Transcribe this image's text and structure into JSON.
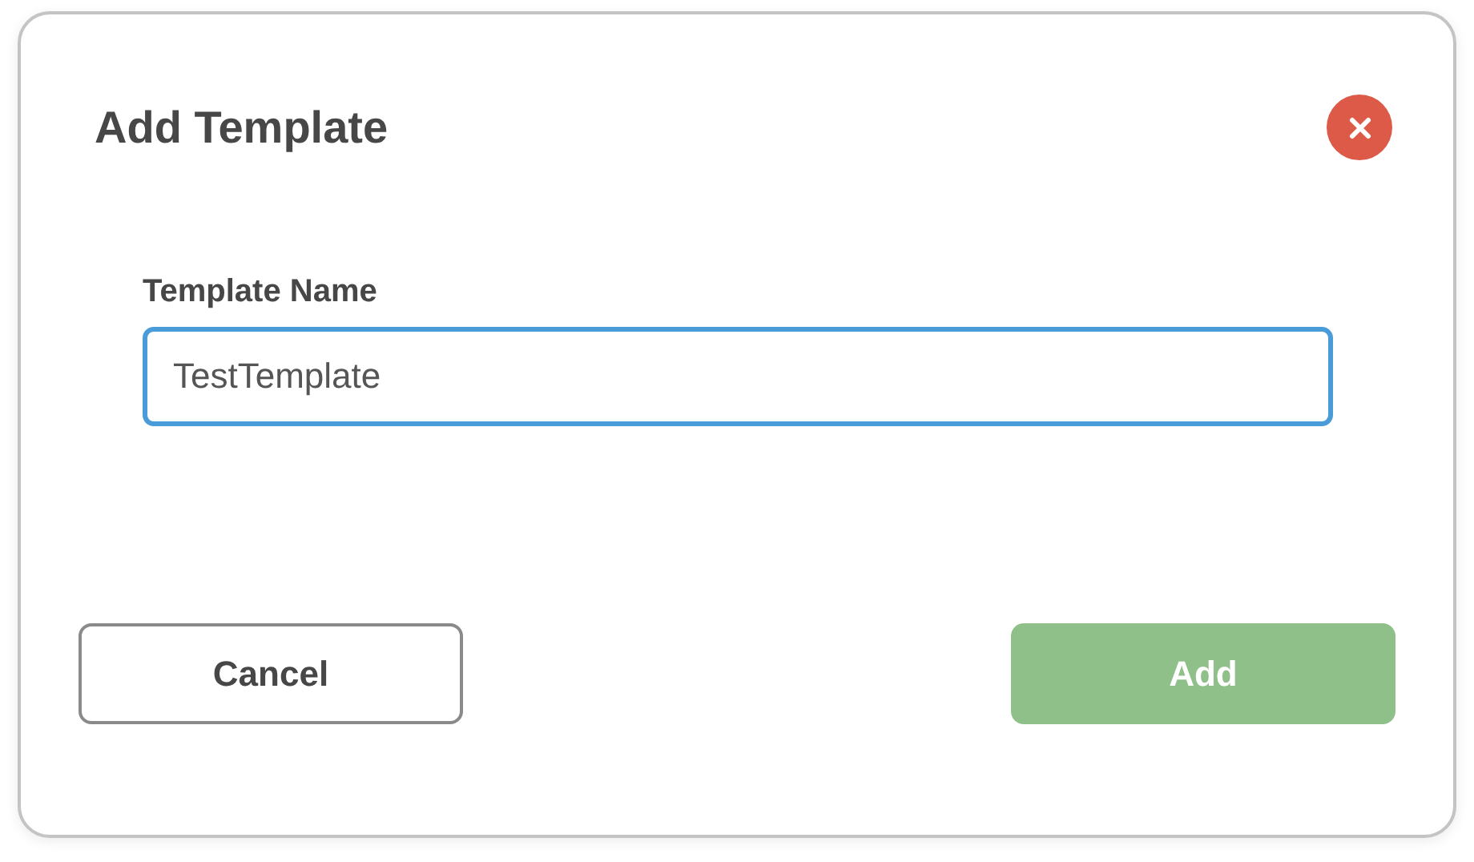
{
  "dialog": {
    "title": "Add Template",
    "field": {
      "label": "Template Name",
      "value": "TestTemplate"
    },
    "buttons": [
      {
        "label": "Cancel",
        "kind": "secondary"
      },
      {
        "label": "Add",
        "kind": "primary"
      }
    ]
  }
}
